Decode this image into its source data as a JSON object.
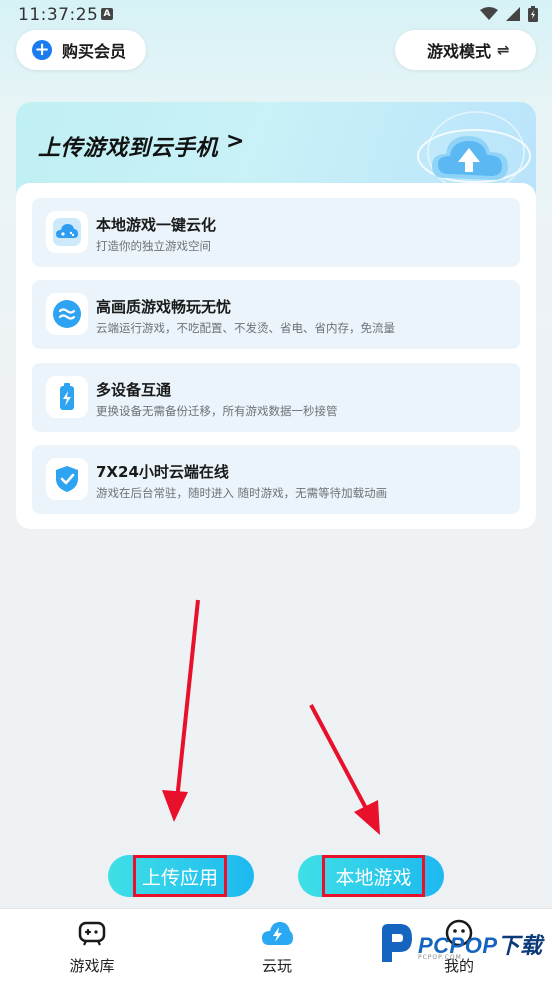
{
  "status_bar": {
    "time": "11:37:25",
    "notification_badge": "A"
  },
  "header": {
    "buy_member_label": "购买会员",
    "game_mode_label": "游戏模式",
    "game_mode_icon": "⇌"
  },
  "banner": {
    "title": "上传游戏到云手机",
    "chevron": ">"
  },
  "features": [
    {
      "title": "本地游戏一键云化",
      "desc": "打造你的独立游戏空间",
      "icon": "cloud-gamepad-icon"
    },
    {
      "title": "高画质游戏畅玩无忧",
      "desc": "云端运行游戏，不吃配置、不发烫、省电、省内存，免流量",
      "icon": "waves-icon"
    },
    {
      "title": "多设备互通",
      "desc": "更换设备无需备份迁移，所有游戏数据一秒接管",
      "icon": "battery-bolt-icon"
    },
    {
      "title": "7X24小时云端在线",
      "desc": "游戏在后台常驻，随时进入 随时游戏，无需等待加载动画",
      "icon": "shield-check-icon"
    }
  ],
  "actions": {
    "upload_app": "上传应用",
    "local_game": "本地游戏"
  },
  "bottom_nav": {
    "library": "游戏库",
    "cloud": "云玩",
    "mine": "我的"
  },
  "watermark": {
    "brand": "PCPOP",
    "cn": "下载",
    "sub": "PCPOP.COM"
  },
  "colors": {
    "accent_blue": "#1a7cf0",
    "button_gradient_start": "#3fe0e6",
    "button_gradient_end": "#1db8f0",
    "annotation_red": "#e8102a"
  }
}
